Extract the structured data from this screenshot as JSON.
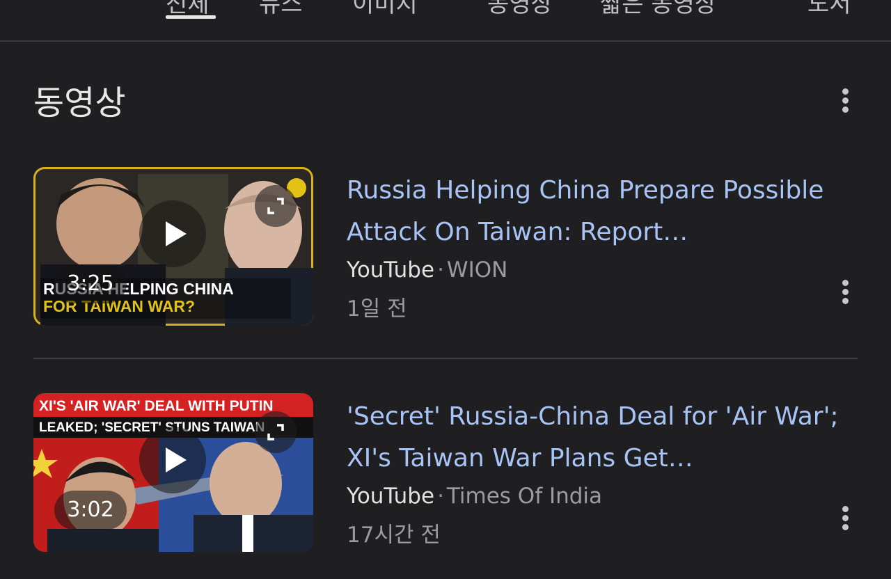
{
  "tabs": [
    {
      "label": "전체"
    },
    {
      "label": "뉴스"
    },
    {
      "label": "이미지"
    },
    {
      "label": "동영상"
    },
    {
      "label": "짧은 동영상"
    },
    {
      "label": "도서"
    }
  ],
  "section": {
    "title": "동영상"
  },
  "videos": [
    {
      "title": "Russia Helping China Prepare Possible Attack On Taiwan: Report…",
      "source": "YouTube",
      "separator": "·",
      "channel": "WION",
      "age": "1일 전",
      "duration": "3:25",
      "thumbnail_caption_line1": "RUSSIA HELPING CHINA",
      "thumbnail_caption_line2": "FOR TAIWAN WAR?"
    },
    {
      "title": "'Secret' Russia-China Deal for 'Air War'; XI's Taiwan War Plans Get…",
      "source": "YouTube",
      "separator": "·",
      "channel": "Times Of India",
      "age": "17시간 전",
      "duration": "3:02",
      "thumbnail_caption_line1": "XI'S 'AIR WAR' DEAL WITH PUTIN",
      "thumbnail_caption_line2": "LEAKED; 'SECRET' STUNS TAIWAN"
    }
  ],
  "colors": {
    "background": "#1f1f21",
    "title_link": "#a8c4f6",
    "meta_text": "#9b9ca0",
    "divider": "#3c3e44"
  }
}
